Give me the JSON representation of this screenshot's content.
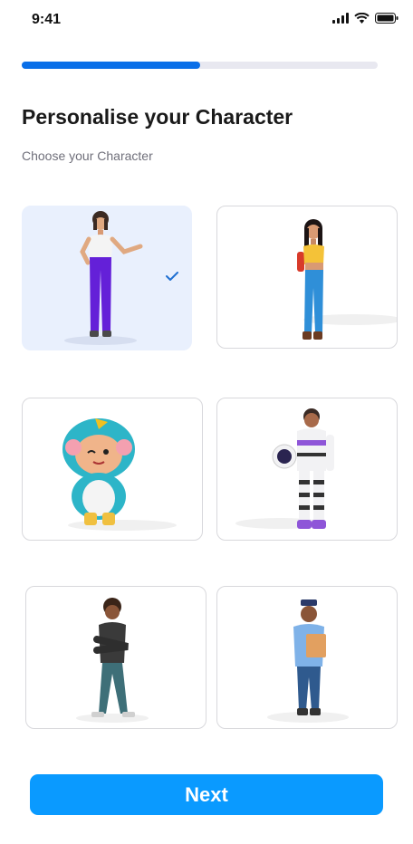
{
  "status_bar": {
    "time": "9:41"
  },
  "progress": {
    "value": 0.5
  },
  "header": {
    "title": "Personalise your Character",
    "subtitle": "Choose your Character"
  },
  "characters": [
    {
      "id": "woman-white-top",
      "selected": true
    },
    {
      "id": "girl-yellow-top-backpack",
      "selected": false
    },
    {
      "id": "penguin-costume-kid",
      "selected": false
    },
    {
      "id": "astronaut",
      "selected": false
    },
    {
      "id": "boy-crossed-arms",
      "selected": false
    },
    {
      "id": "police-officer",
      "selected": false
    }
  ],
  "footer": {
    "next_label": "Next"
  },
  "colors": {
    "accent": "#0a9aff",
    "progress": "#0a6fe8",
    "selected_bg": "#e9f0fd"
  }
}
